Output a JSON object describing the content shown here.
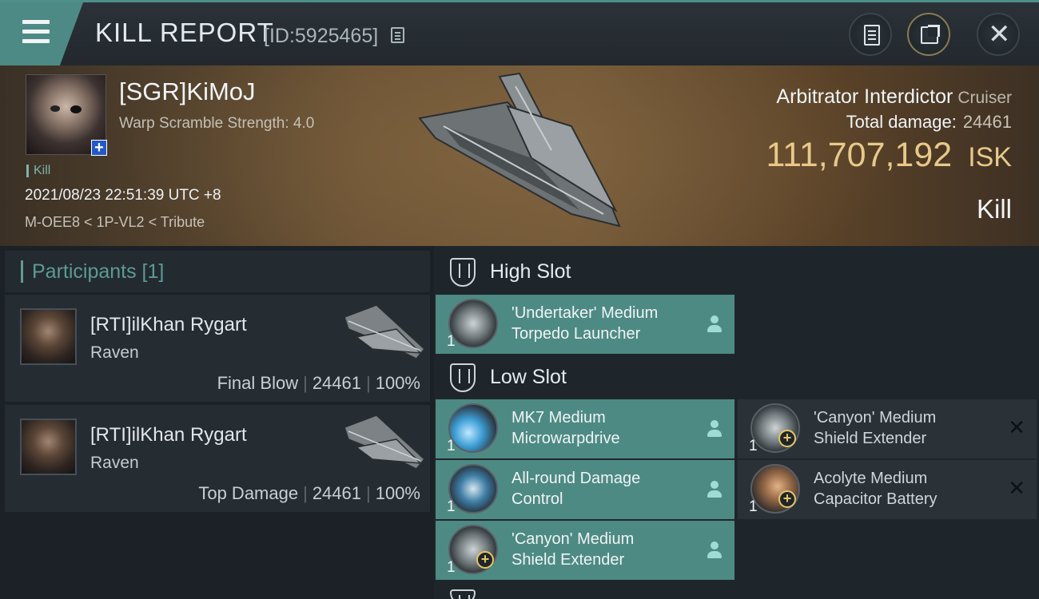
{
  "header": {
    "title": "KILL REPORT",
    "report_id": "[ID:5925465]"
  },
  "victim": {
    "name": "[SGR]KiMoJ",
    "warp_scramble": "Warp Scramble Strength: 4.0",
    "tag": "Kill",
    "datetime": "2021/08/23 22:51:39 UTC +8",
    "location": "M-OEE8 < 1P-VL2 < Tribute",
    "ship": "Arbitrator Interdictor",
    "ship_class": "Cruiser",
    "total_damage_label": "Total damage:",
    "total_damage": "24461",
    "isk_value": "111,707,192",
    "isk_unit": "ISK",
    "result": "Kill"
  },
  "participants": {
    "title": "Participants [1]",
    "rows": [
      {
        "name": "[RTI]ilKhan Rygart",
        "ship": "Raven",
        "role": "Final Blow",
        "damage": "24461",
        "percent": "100%"
      },
      {
        "name": "[RTI]ilKhan Rygart",
        "ship": "Raven",
        "role": "Top Damage",
        "damage": "24461",
        "percent": "100%"
      }
    ]
  },
  "fitting": {
    "high_slot": {
      "title": "High Slot",
      "modules": [
        {
          "line1": "'Undertaker' Medium",
          "line2": "Torpedo Launcher",
          "qty": "1"
        }
      ]
    },
    "low_slot": {
      "title": "Low Slot",
      "modules": [
        {
          "line1": "MK7 Medium",
          "line2": "Microwarpdrive",
          "qty": "1"
        },
        {
          "line1": "All-round Damage",
          "line2": "Control",
          "qty": "1"
        },
        {
          "line1": "'Canyon' Medium",
          "line2": "Shield Extender",
          "qty": "1"
        }
      ],
      "dropped": [
        {
          "line1": "'Canyon' Medium",
          "line2": "Shield Extender",
          "qty": "1"
        },
        {
          "line1": "Acolyte Medium",
          "line2": "Capacitor Battery",
          "qty": "1"
        }
      ]
    }
  },
  "colors": {
    "accent": "#4d8a85",
    "isk_gold": "#e8c98a"
  }
}
